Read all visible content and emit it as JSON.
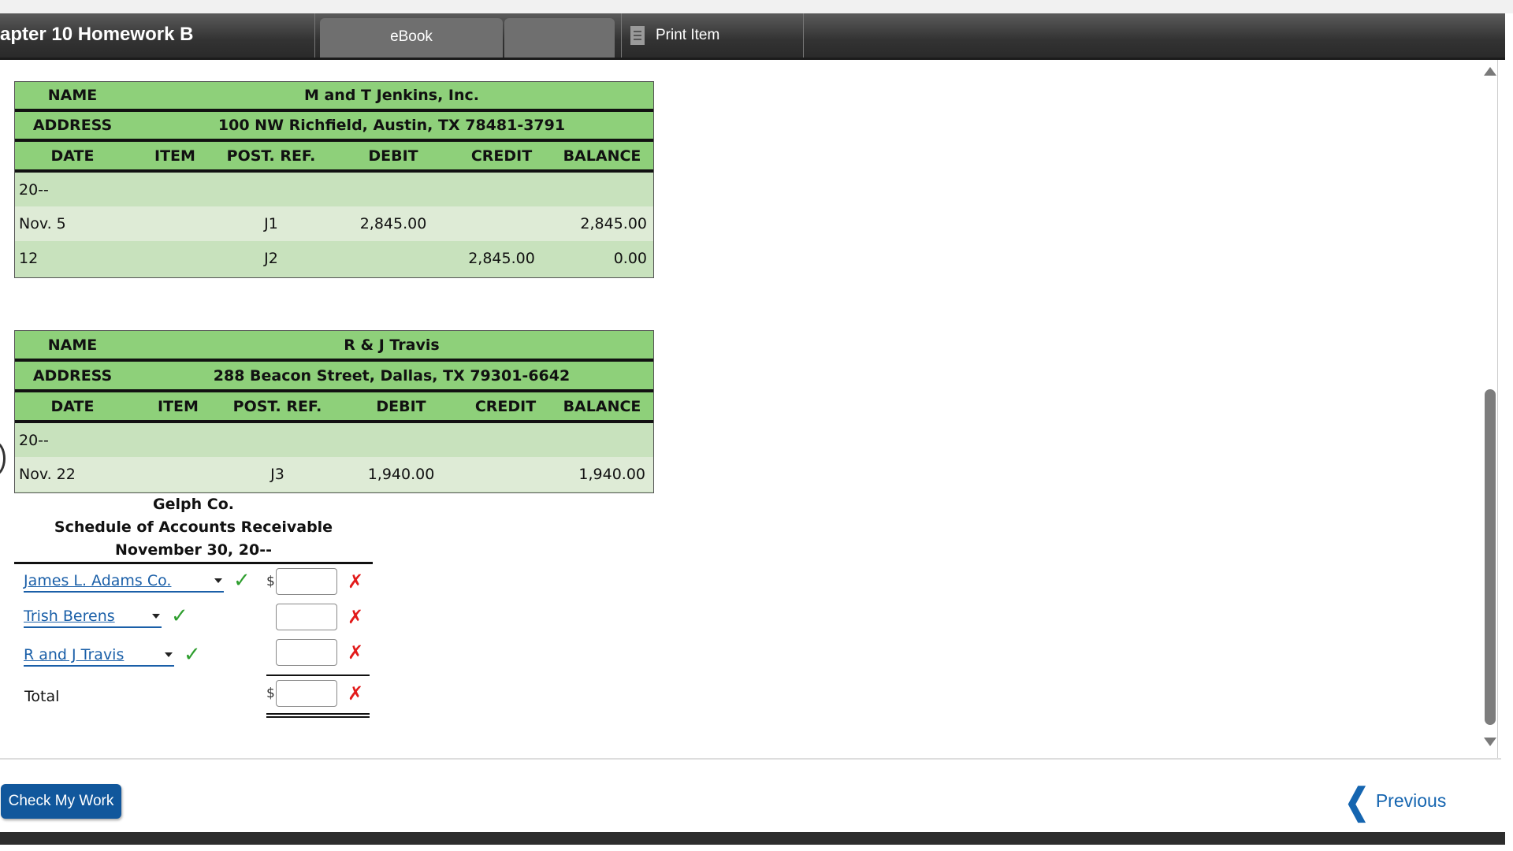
{
  "header": {
    "title": "apter 10 Homework B",
    "tabs": [
      {
        "label": "eBook"
      },
      {
        "label": ""
      }
    ],
    "print_label": "Print Item"
  },
  "ledgers": [
    {
      "name_label": "NAME",
      "name": "M and T Jenkins, Inc.",
      "address_label": "ADDRESS",
      "address": "100 NW Richfield, Austin, TX 78481-3791",
      "columns": [
        "DATE",
        "ITEM",
        "POST. REF.",
        "DEBIT",
        "CREDIT",
        "BALANCE"
      ],
      "rows": [
        {
          "date": "20--",
          "item": "",
          "post_ref": "",
          "debit": "",
          "credit": "",
          "balance": ""
        },
        {
          "date": "Nov. 5",
          "item": "",
          "post_ref": "J1",
          "debit": "2,845.00",
          "credit": "",
          "balance": "2,845.00"
        },
        {
          "date": "12",
          "item": "",
          "post_ref": "J2",
          "debit": "",
          "credit": "2,845.00",
          "balance": "0.00"
        }
      ]
    },
    {
      "name_label": "NAME",
      "name": "R & J Travis",
      "address_label": "ADDRESS",
      "address": "288 Beacon Street, Dallas, TX 79301-6642",
      "columns": [
        "DATE",
        "ITEM",
        "POST. REF.",
        "DEBIT",
        "CREDIT",
        "BALANCE"
      ],
      "rows": [
        {
          "date": "20--",
          "item": "",
          "post_ref": "",
          "debit": "",
          "credit": "",
          "balance": ""
        },
        {
          "date": "Nov. 22",
          "item": "",
          "post_ref": "J3",
          "debit": "1,940.00",
          "credit": "",
          "balance": "1,940.00"
        }
      ]
    }
  ],
  "schedule": {
    "company": "Gelph Co.",
    "title": "Schedule of Accounts Receivable",
    "date": "November 30, 20--",
    "rows": [
      {
        "customer": "James L. Adams Co.",
        "currency": "$",
        "amount": ""
      },
      {
        "customer": "Trish Berens",
        "currency": "",
        "amount": ""
      },
      {
        "customer": "R and J Travis",
        "currency": "",
        "amount": ""
      }
    ],
    "total_label": "Total",
    "total_currency": "$",
    "total_amount": ""
  },
  "footer": {
    "check_label": "Check My Work",
    "prev_label": "Previous"
  },
  "colors": {
    "ledger_header": "#8ed07a",
    "row_light": "#deebd6",
    "row_dark": "#c8e2bd",
    "link_blue": "#1a5fa8",
    "check_green": "#2e9e2e",
    "error_red": "#e21a1a",
    "button_blue": "#11579c"
  }
}
